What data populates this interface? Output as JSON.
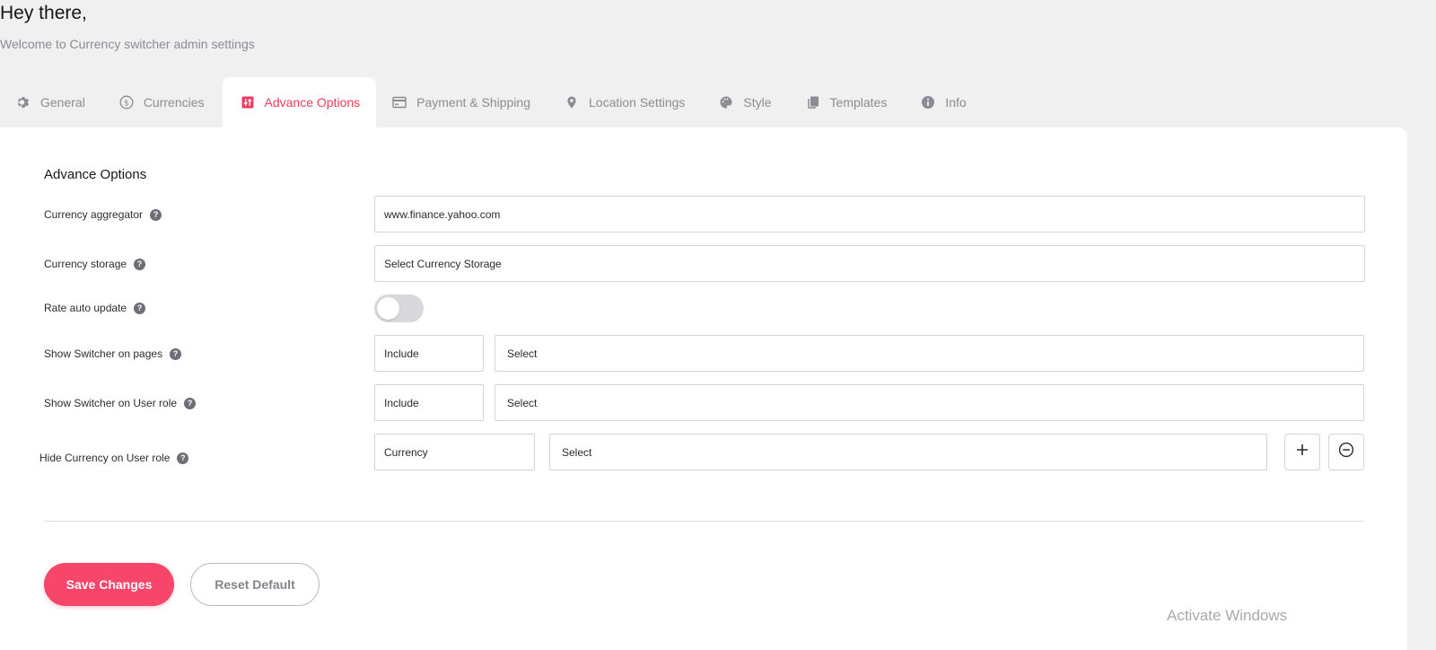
{
  "header": {
    "greeting": "Hey there,",
    "welcome": "Welcome to Currency switcher admin settings"
  },
  "tabs": [
    {
      "label": "General",
      "icon": "gear-icon"
    },
    {
      "label": "Currencies",
      "icon": "dollar-circle-icon"
    },
    {
      "label": "Advance Options",
      "icon": "sliders-icon",
      "active": true
    },
    {
      "label": "Payment & Shipping",
      "icon": "payment-card-icon"
    },
    {
      "label": "Location Settings",
      "icon": "location-pin-icon"
    },
    {
      "label": "Style",
      "icon": "palette-icon"
    },
    {
      "label": "Templates",
      "icon": "copy-icon"
    },
    {
      "label": "Info",
      "icon": "info-icon"
    }
  ],
  "colors": {
    "accent": "#f43a5d",
    "save_button": "#f8456a"
  },
  "section": {
    "title": "Advance Options",
    "aggregator": {
      "label": "Currency aggregator",
      "value": "www.finance.yahoo.com"
    },
    "storage": {
      "label": "Currency storage",
      "value": "Select Currency Storage"
    },
    "auto_update": {
      "label": "Rate auto update",
      "on": false
    },
    "switcher_pages": {
      "label": "Show Switcher on pages",
      "mode": "Include",
      "select": "Select"
    },
    "switcher_role": {
      "label": "Show Switcher on User role",
      "mode": "Include",
      "select": "Select"
    },
    "hide_currency": {
      "label": "Hide Currency on User role",
      "currency": "Currency",
      "select": "Select"
    }
  },
  "actions": {
    "save": "Save Changes",
    "reset": "Reset Default"
  },
  "watermark": "Activate Windows"
}
